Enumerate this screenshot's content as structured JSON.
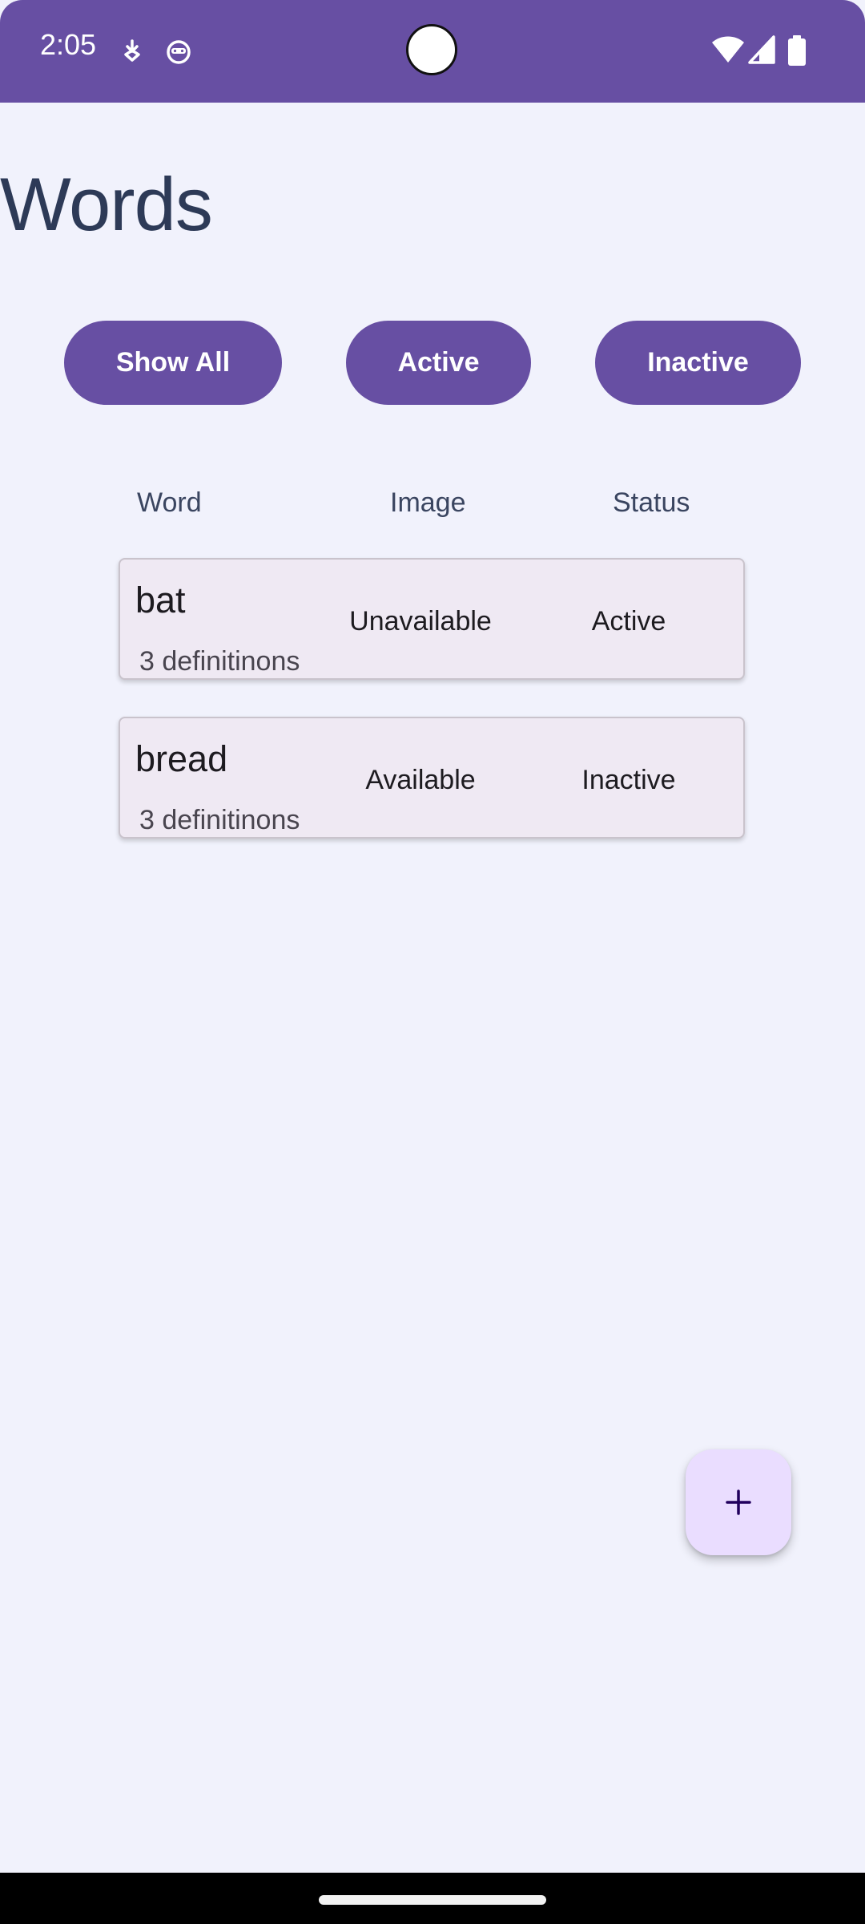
{
  "status_bar": {
    "time": "2:05",
    "notification_icons": [
      "download-icon",
      "android-face-icon"
    ],
    "system_icons": [
      "wifi-icon",
      "signal-icon",
      "battery-icon"
    ],
    "color": "#674fa3"
  },
  "header": {
    "title": "Words"
  },
  "filters": {
    "show_all": "Show All",
    "active": "Active",
    "inactive": "Inactive"
  },
  "columns": {
    "word": "Word",
    "image": "Image",
    "status": "Status"
  },
  "words": [
    {
      "word": "bat",
      "definitions": "3 definitinons",
      "image": "Unavailable",
      "status": "Active"
    },
    {
      "word": "bread",
      "definitions": "3 definitinons",
      "image": "Available",
      "status": "Inactive"
    }
  ],
  "fab": {
    "icon": "plus-icon",
    "label": "+"
  },
  "colors": {
    "primary": "#674fa3",
    "background": "#f1f2fc",
    "card": "#efe9f3",
    "fab": "#eaddff",
    "title": "#2d3a57"
  }
}
